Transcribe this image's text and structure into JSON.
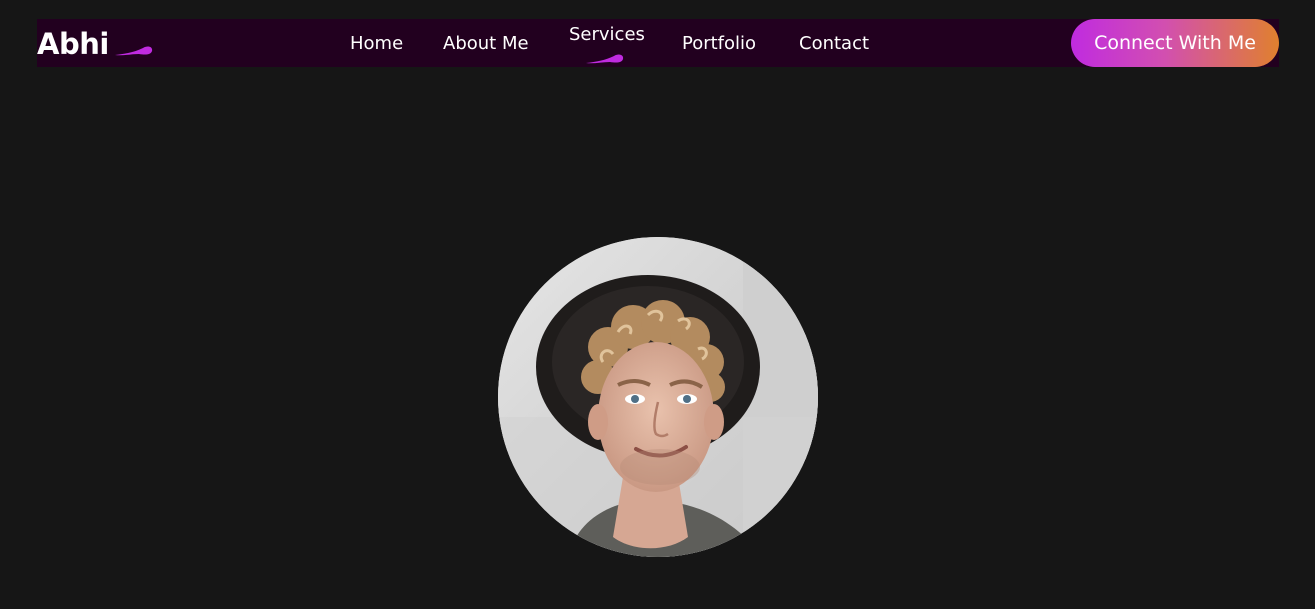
{
  "brand": {
    "name": "Abhi",
    "accent_color": "#c02be0"
  },
  "nav": {
    "items": [
      {
        "label": "Home",
        "active": false
      },
      {
        "label": "About Me",
        "active": false
      },
      {
        "label": "Services",
        "active": true
      },
      {
        "label": "Portfolio",
        "active": false
      },
      {
        "label": "Contact",
        "active": false
      }
    ]
  },
  "cta": {
    "label": "Connect With Me",
    "gradient": [
      "#c02be0",
      "#e0802e"
    ]
  },
  "hero": {
    "avatar_icon": "profile-photo"
  },
  "colors": {
    "page_bg": "#161616",
    "navbar_bg": "#22001f"
  }
}
